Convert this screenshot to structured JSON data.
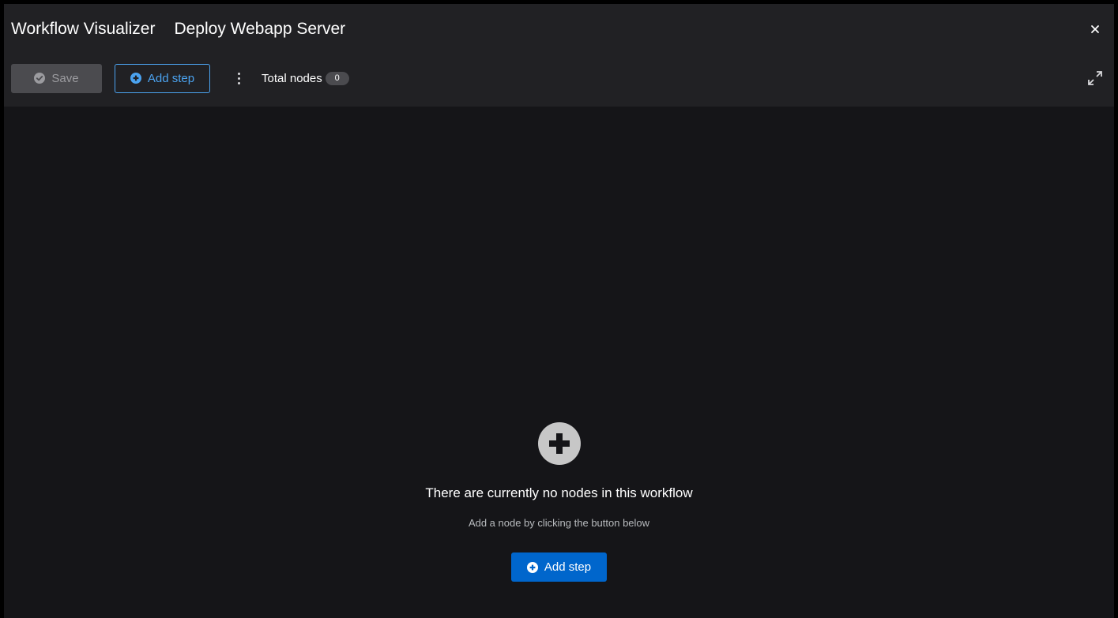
{
  "header": {
    "title": "Workflow Visualizer",
    "workflow_name": "Deploy Webapp Server",
    "close_icon": "close-icon",
    "expand_icon": "expand-icon"
  },
  "toolbar": {
    "save_label": "Save",
    "add_step_label": "Add step",
    "total_nodes_label": "Total nodes",
    "total_nodes_count": "0",
    "kebab_icon": "kebab-icon"
  },
  "empty_state": {
    "icon": "plus-circle-icon",
    "title": "There are currently no nodes in this workflow",
    "description": "Add a node by clicking the button below",
    "add_step_label": "Add step"
  },
  "colors": {
    "background": "#151518",
    "header": "#212124",
    "accent": "#0066cc",
    "link": "#4ba3f0",
    "disabled": "#4b4b4f"
  }
}
